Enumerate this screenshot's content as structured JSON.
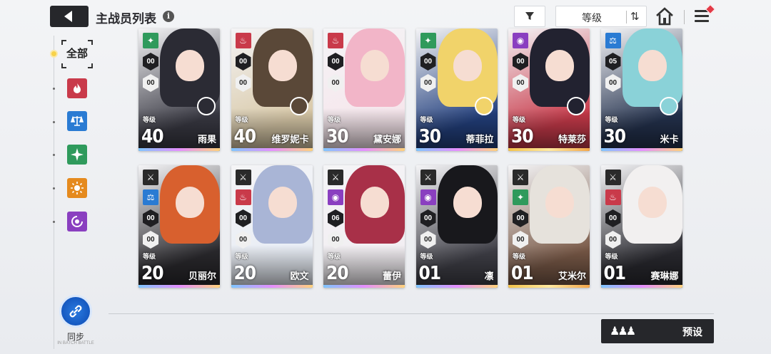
{
  "header": {
    "title": "主战员列表",
    "sort_label": "等级"
  },
  "sidebar": {
    "all_label": "全部",
    "sync_label": "同步",
    "sync_sublabel": "IN BATCH BATTLE"
  },
  "elements": [
    {
      "name": "fire",
      "color": "#c93a4a"
    },
    {
      "name": "balance",
      "color": "#2a7bd3"
    },
    {
      "name": "wind",
      "color": "#2f9a5c"
    },
    {
      "name": "sun",
      "color": "#e58a1e"
    },
    {
      "name": "void",
      "color": "#8a3fc0"
    }
  ],
  "level_label": "等级",
  "cards": [
    {
      "name": "雨果",
      "level": "40",
      "element": "wind",
      "elem_color": "#2f9a5c",
      "badge1": "00",
      "badge2": "00",
      "hair": "#2b2b34",
      "bg": "#3a3a44",
      "has_avatar": true,
      "new": false,
      "gold": false
    },
    {
      "name": "维罗妮卡",
      "level": "40",
      "element": "fire",
      "elem_color": "#c93a4a",
      "badge1": "00",
      "badge2": "00",
      "hair": "#5a4838",
      "bg": "#d9c9a8",
      "has_avatar": true,
      "new": false,
      "gold": false
    },
    {
      "name": "黛安娜",
      "level": "30",
      "element": "fire",
      "elem_color": "#c93a4a",
      "badge1": "00",
      "badge2": "00",
      "hair": "#f2b5c8",
      "bg": "#f6e6ec",
      "has_avatar": false,
      "new": false,
      "gold": false
    },
    {
      "name": "蒂菲拉",
      "level": "30",
      "element": "wind",
      "elem_color": "#2f9a5c",
      "badge1": "00",
      "badge2": "00",
      "hair": "#f1d36a",
      "bg": "#23407e",
      "has_avatar": true,
      "new": false,
      "gold": false
    },
    {
      "name": "特莱莎",
      "level": "30",
      "element": "void",
      "elem_color": "#8a3fc0",
      "badge1": "00",
      "badge2": "00",
      "hair": "#222230",
      "bg": "#c83a4a",
      "has_avatar": true,
      "new": false,
      "gold": true
    },
    {
      "name": "米卡",
      "level": "30",
      "element": "balance",
      "elem_color": "#2a7bd3",
      "badge1": "05",
      "badge2": "00",
      "hair": "#8ad2d8",
      "bg": "#24324e",
      "has_avatar": true,
      "new": false,
      "gold": false
    },
    {
      "name": "贝丽尔",
      "level": "20",
      "element": "balance",
      "elem_color": "#2a7bd3",
      "badge1": "00",
      "badge2": "00",
      "hair": "#d8602e",
      "bg": "#2b2a2e",
      "has_avatar": false,
      "new": true,
      "gold": false
    },
    {
      "name": "欧文",
      "level": "20",
      "element": "fire",
      "elem_color": "#c93a4a",
      "badge1": "00",
      "badge2": "00",
      "hair": "#a9b5d6",
      "bg": "#e8edf5",
      "has_avatar": false,
      "new": false,
      "gold": false
    },
    {
      "name": "蕾伊",
      "level": "20",
      "element": "void",
      "elem_color": "#8a3fc0",
      "badge1": "06",
      "badge2": "00",
      "hair": "#a83048",
      "bg": "#f2eef2",
      "has_avatar": false,
      "new": false,
      "gold": false
    },
    {
      "name": "凛",
      "level": "01",
      "element": "void",
      "elem_color": "#8a3fc0",
      "badge1": "00",
      "badge2": "00",
      "hair": "#18181c",
      "bg": "#404048",
      "has_avatar": false,
      "new": false,
      "gold": false
    },
    {
      "name": "艾米尔",
      "level": "01",
      "element": "wind",
      "elem_color": "#2f9a5c",
      "badge1": "00",
      "badge2": "00",
      "hair": "#e6e2dc",
      "bg": "#7a5a48",
      "has_avatar": false,
      "new": true,
      "gold": true
    },
    {
      "name": "赛琳娜",
      "level": "01",
      "element": "fire",
      "elem_color": "#c93a4a",
      "badge1": "00",
      "badge2": "00",
      "hair": "#f2f0f0",
      "bg": "#2a2a30",
      "has_avatar": false,
      "new": false,
      "gold": false
    }
  ],
  "footer": {
    "preset_label": "预设"
  }
}
